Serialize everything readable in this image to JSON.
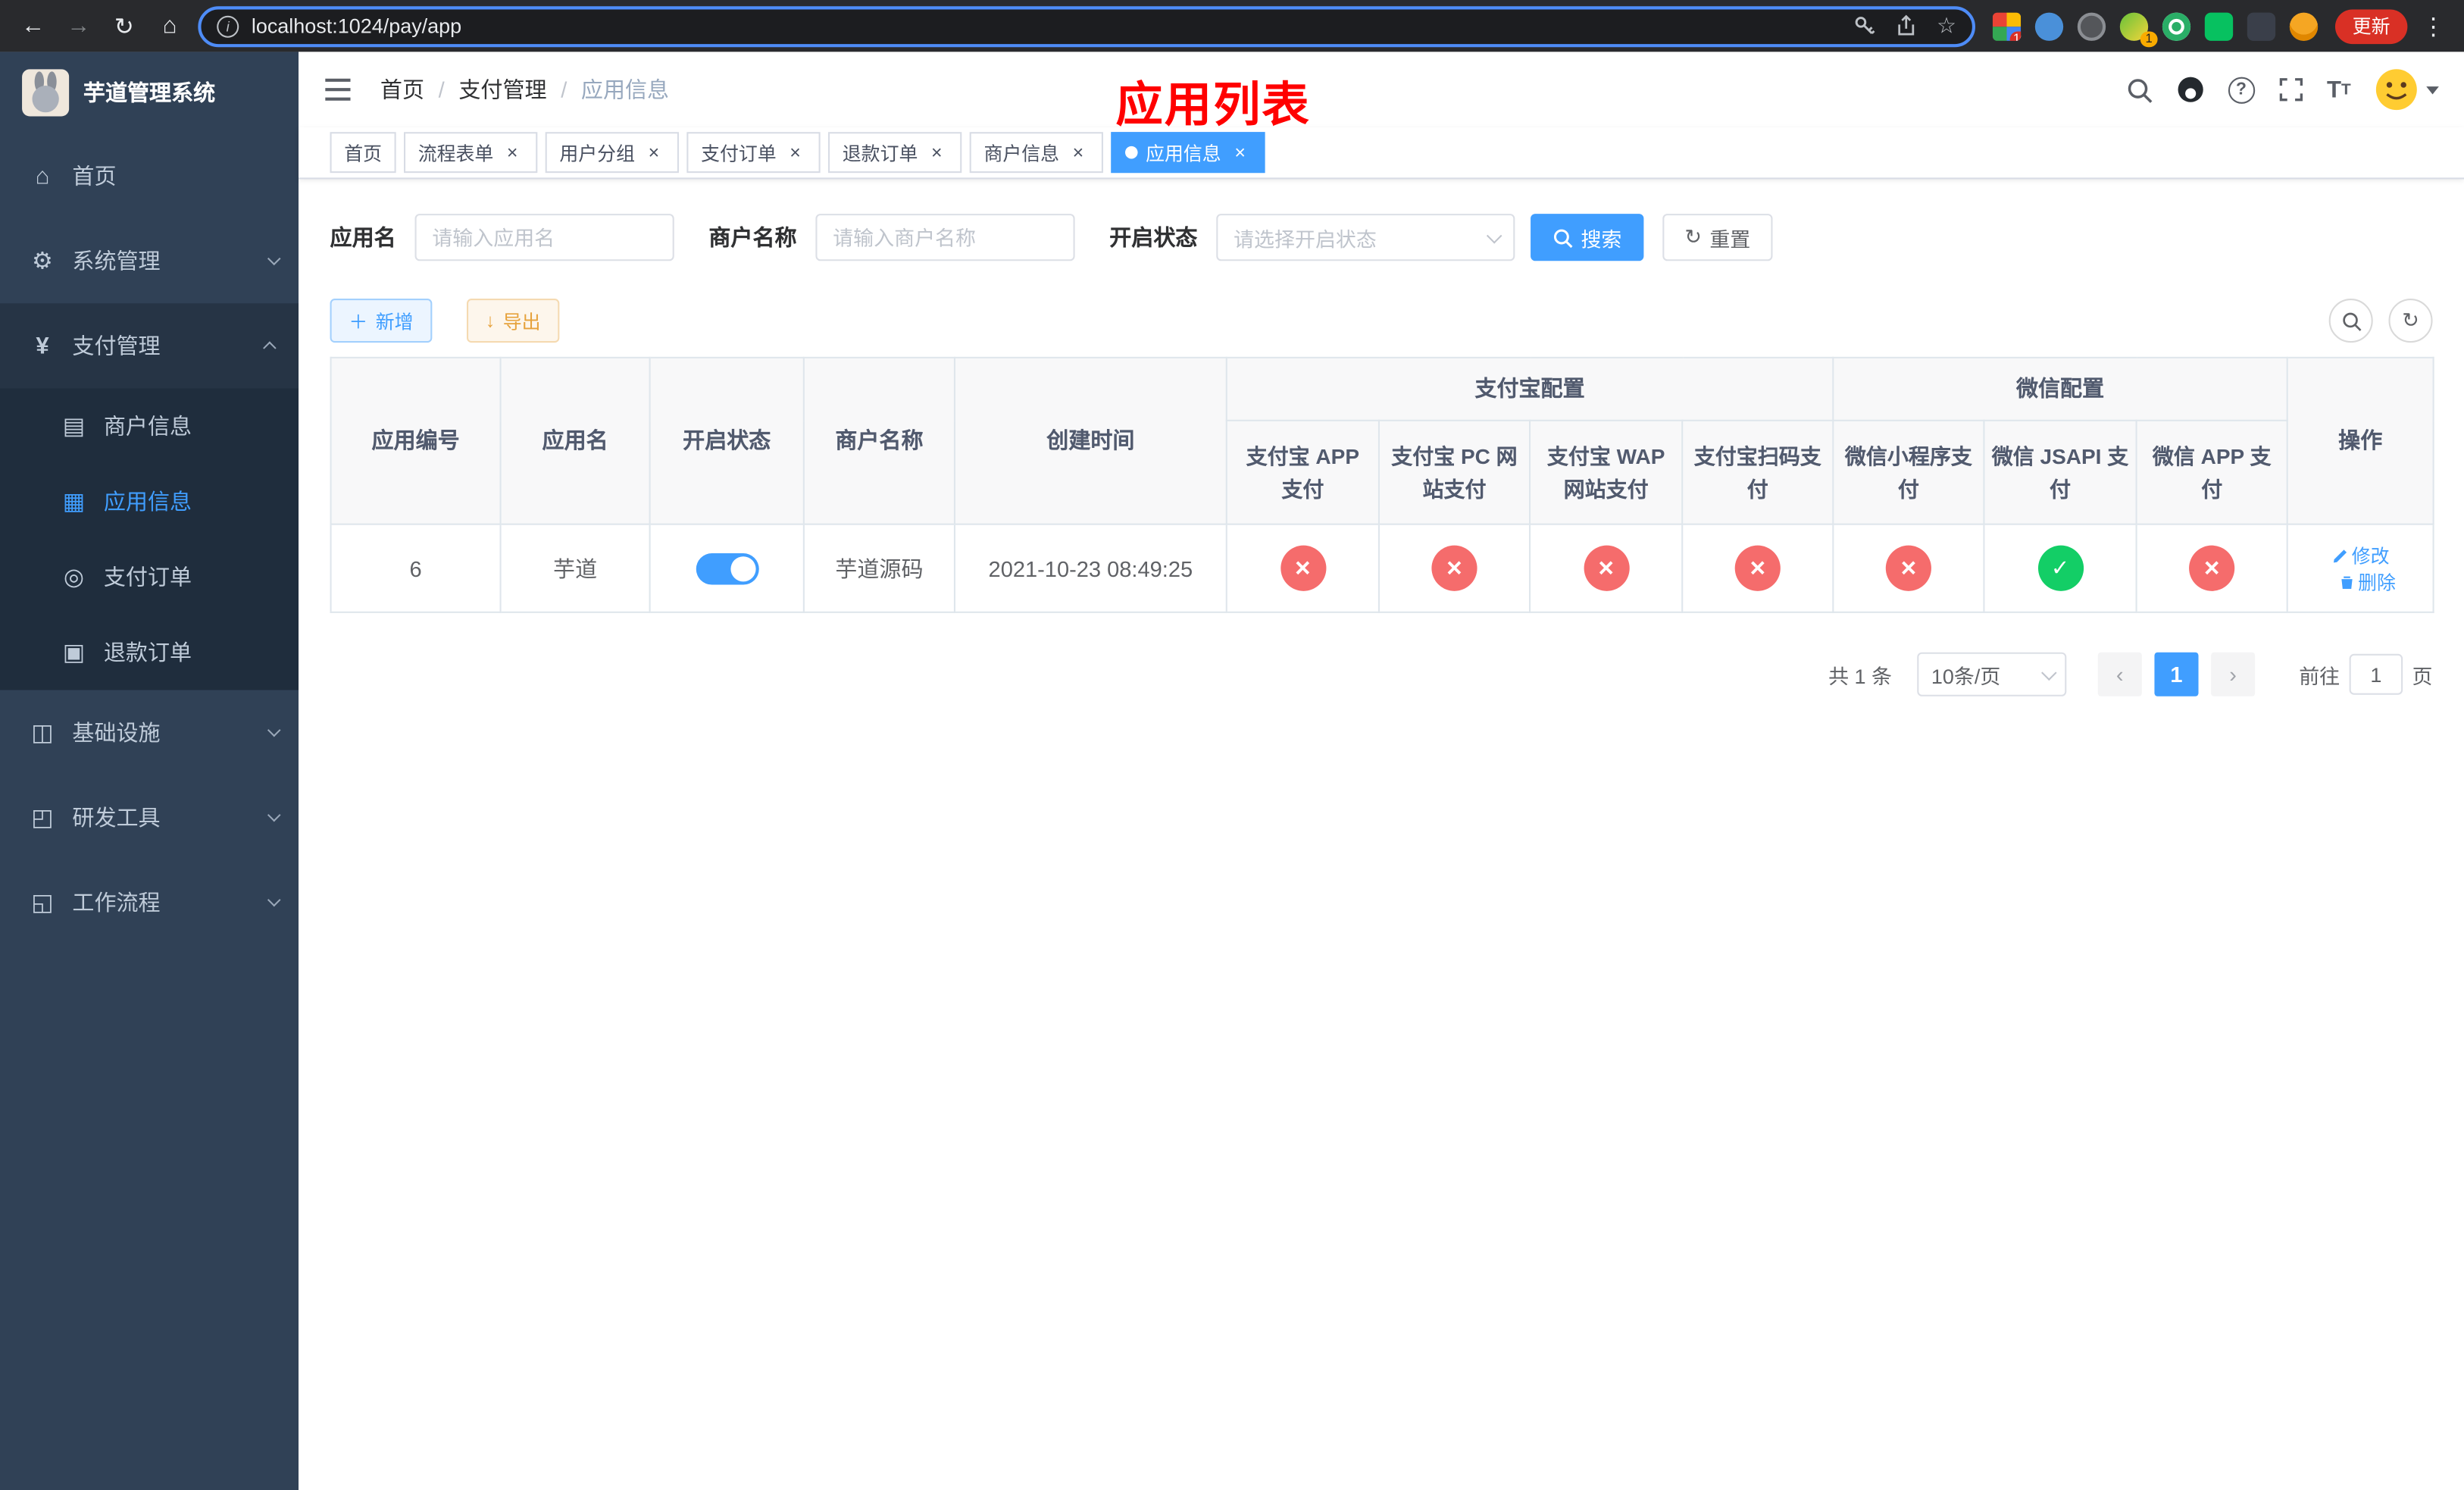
{
  "browser": {
    "url": "localhost:1024/pay/app",
    "update_label": "更新",
    "badges": {
      "ext1": "10",
      "ext4": "1"
    }
  },
  "sidebar": {
    "title": "芋道管理系统",
    "items": [
      {
        "label": "首页"
      },
      {
        "label": "系统管理"
      },
      {
        "label": "支付管理"
      },
      {
        "label": "基础设施"
      },
      {
        "label": "研发工具"
      },
      {
        "label": "工作流程"
      }
    ],
    "payment_children": [
      {
        "label": "商户信息"
      },
      {
        "label": "应用信息"
      },
      {
        "label": "支付订单"
      },
      {
        "label": "退款订单"
      }
    ]
  },
  "navbar": {
    "breadcrumb": [
      "首页",
      "支付管理",
      "应用信息"
    ],
    "overlay_title": "应用列表"
  },
  "tabs": [
    {
      "label": "首页"
    },
    {
      "label": "流程表单"
    },
    {
      "label": "用户分组"
    },
    {
      "label": "支付订单"
    },
    {
      "label": "退款订单"
    },
    {
      "label": "商户信息"
    },
    {
      "label": "应用信息"
    }
  ],
  "filters": {
    "app_name_label": "应用名",
    "app_name_placeholder": "请输入应用名",
    "merchant_label": "商户名称",
    "merchant_placeholder": "请输入商户名称",
    "status_label": "开启状态",
    "status_placeholder": "请选择开启状态",
    "search_label": "搜索",
    "reset_label": "重置"
  },
  "toolbar": {
    "add_label": "新增",
    "export_label": "导出"
  },
  "table": {
    "headers": {
      "app_id": "应用编号",
      "app_name": "应用名",
      "status": "开启状态",
      "merchant": "商户名称",
      "created": "创建时间",
      "alipay_group": "支付宝配置",
      "wechat_group": "微信配置",
      "actions": "操作",
      "sub": [
        "支付宝 APP 支付",
        "支付宝 PC 网站支付",
        "支付宝 WAP 网站支付",
        "支付宝扫码支付",
        "微信小程序支付",
        "微信 JSAPI 支付",
        "微信 APP 支付"
      ]
    },
    "rows": [
      {
        "id": "6",
        "name": "芋道",
        "enabled": "on",
        "merchant": "芋道源码",
        "created": "2021-10-23 08:49:25",
        "configs": [
          "no",
          "no",
          "no",
          "no",
          "no",
          "yes",
          "no"
        ],
        "edit_label": "修改",
        "delete_label": "删除"
      }
    ]
  },
  "pagination": {
    "total": "共 1 条",
    "page_size": "10条/页",
    "page": "1",
    "goto_label": "前往",
    "goto_value": "1",
    "goto_suffix": "页"
  }
}
